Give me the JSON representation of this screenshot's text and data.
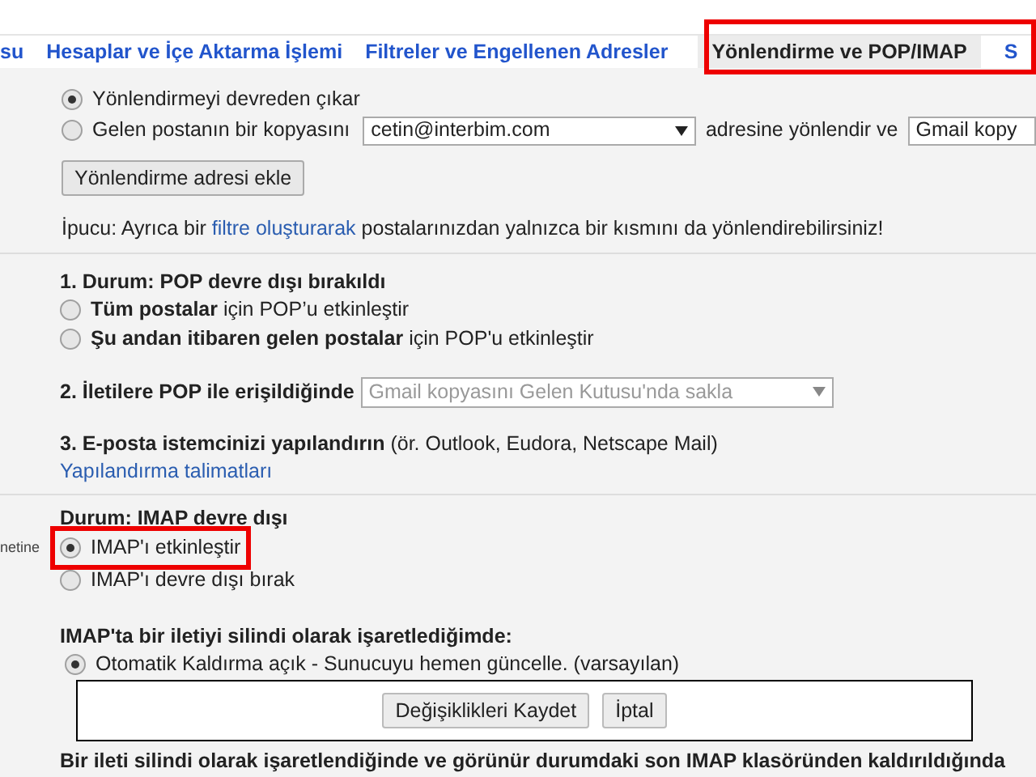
{
  "tabs": [
    {
      "label": "su",
      "selected": false
    },
    {
      "label": "Hesaplar ve İçe Aktarma İşlemi",
      "selected": false
    },
    {
      "label": "Filtreler ve Engellenen Adresler",
      "selected": false
    },
    {
      "label": "Yönlendirme ve POP/IMAP",
      "selected": true
    },
    {
      "label": "S",
      "selected": false
    }
  ],
  "forwarding": {
    "options": [
      {
        "label": "Yönlendirmeyi devreden çıkar",
        "selected": true
      },
      {
        "label": "Gelen postanın bir kopyasını",
        "selected": false
      }
    ],
    "address": "cetin@interbim.com",
    "middle_text": "adresine yönlendir ve",
    "action": "Gmail kopy",
    "add_button": "Yönlendirme adresi ekle",
    "tip": "İpucu: Ayrıca bir ",
    "tip_link": "filtre oluşturarak",
    "tip_rest": " postalarınızdan yalnızca bir kısmını da yönlendirebilirsiniz!"
  },
  "pop": {
    "heading": "1. Durum: POP devre dışı bırakıldı",
    "options": [
      {
        "label": "**Tüm postalar** için POP’u etkinleştir",
        "selected": false
      },
      {
        "label": "**Şu andan itibaren gelen postalar** için POP'u etkinleştir",
        "selected": false
      }
    ],
    "access_label": "2. İletilere POP ile erişildiğinde",
    "access_value": "Gmail kopyasını Gelen Kutusu'nda sakla",
    "access_disabled": true,
    "client_heading": "3. E-posta istemcinizi yapılandırın",
    "client_note": " (ör. Outlook, Eudora, Netscape Mail)",
    "client_link": "Yapılandırma talimatları"
  },
  "imap": {
    "side_label": "netine",
    "heading": "Durum: IMAP devre dışı",
    "options": [
      {
        "label": "IMAP'ı etkinleştir",
        "selected": true,
        "highlighted": true
      },
      {
        "label": "IMAP'ı devre dışı bırak",
        "selected": false,
        "highlighted": false
      }
    ],
    "delete_heading": "IMAP'ta bir iletiyi silindi olarak işaretlediğimde:",
    "delete_options": [
      {
        "label": "Otomatik Kaldırma açık - Sunucuyu hemen güncelle. (varsayılan)",
        "selected": true
      }
    ],
    "expunge_heading": "Bir ileti silindi olarak işaretlendiğinde ve görünür durumdaki son IMAP klasöründen kaldırıldığında"
  },
  "save_bar": {
    "buttons": [
      "Değişiklikleri Kaydet",
      "İptal"
    ]
  }
}
